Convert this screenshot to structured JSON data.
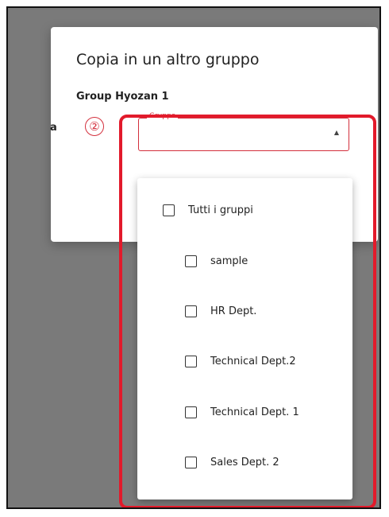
{
  "dialog": {
    "title": "Copia in un altro gruppo",
    "group_name": "Group Hyozan 1",
    "to_label": "a"
  },
  "select": {
    "label": "Gruppo",
    "value": "",
    "arrow_icon": "triangle-up-icon"
  },
  "dropdown": {
    "items": [
      {
        "label": "Tutti i gruppi",
        "checked": false
      },
      {
        "label": "sample",
        "checked": false
      },
      {
        "label": "HR Dept.",
        "checked": false
      },
      {
        "label": "Technical Dept.2",
        "checked": false
      },
      {
        "label": "Technical Dept. 1",
        "checked": false
      },
      {
        "label": "Sales Dept. 2",
        "checked": false
      }
    ]
  },
  "annotation": {
    "number": "②",
    "color": "#e21a2b"
  },
  "colors": {
    "backdrop": "#7a7a7a",
    "accent": "#d32f3c"
  }
}
